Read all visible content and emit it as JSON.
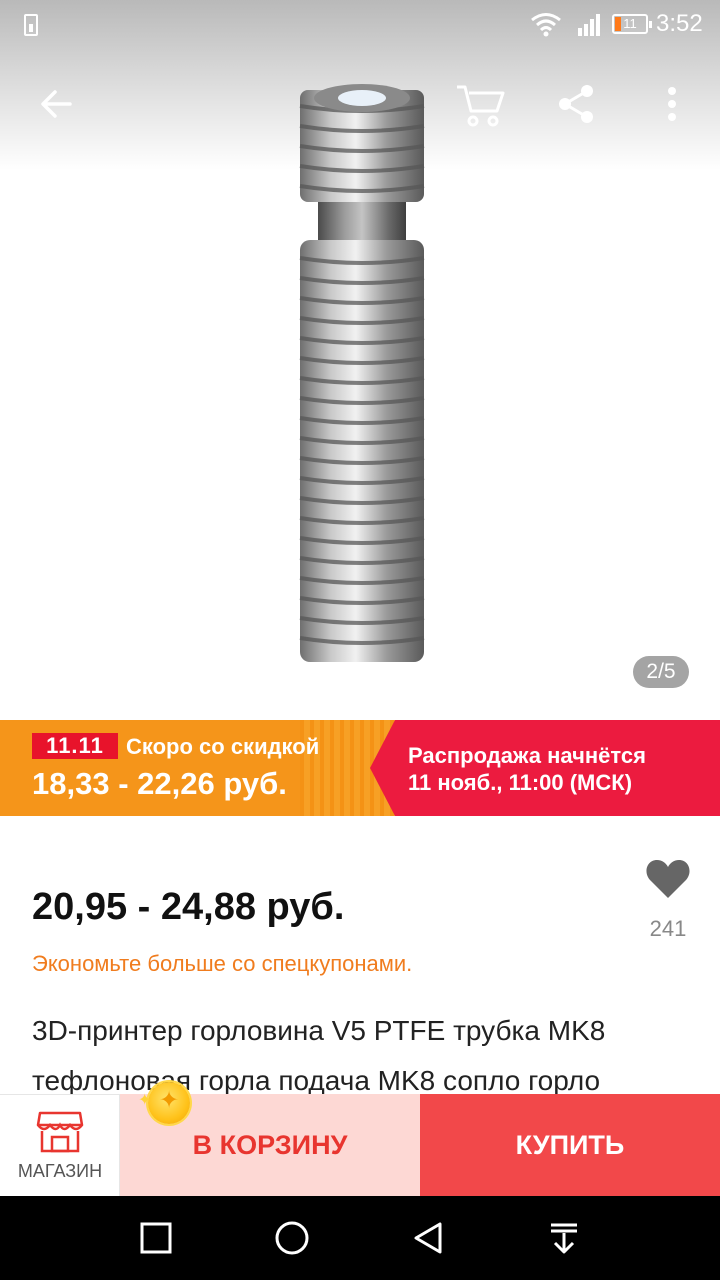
{
  "status_bar": {
    "time": "3:52",
    "battery_level": "11"
  },
  "gallery": {
    "page_indicator": "2/5",
    "current_image": 2,
    "total_images": 5
  },
  "header": {
    "icons": [
      "back-arrow-icon",
      "cart-icon",
      "share-icon",
      "more-vert-icon"
    ]
  },
  "promo": {
    "badge": "11.11",
    "soon_text": "Скоро со скидкой",
    "price_range": "18,33 - 22,26 руб.",
    "sale_start_line1": "Распродажа начнётся",
    "sale_start_line2": "11 нояб., 11:00 (МСК)",
    "colors": {
      "orange": "#f5951a",
      "red": "#ec1b3f"
    }
  },
  "product": {
    "price_range": "20,95 - 24,88 руб.",
    "favorites_count": "241",
    "coupon_text": "Экономьте больше со спецкупонами.",
    "title_line1": "3D-принтер горловина V5 PTFE трубка MK8",
    "title_line2": "тефлоновая горла подача MK8 сопло горло"
  },
  "actions": {
    "store_label": "МАГАЗИН",
    "add_to_cart_label": "В КОРЗИНУ",
    "buy_label": "КУПИТЬ",
    "colors": {
      "cart_bg": "#fdd8d4",
      "cart_text": "#e8352f",
      "buy_bg": "#f2484a"
    }
  },
  "nav": {
    "icons": [
      "recent-apps-icon",
      "home-icon",
      "back-icon",
      "notification-pull-icon"
    ]
  }
}
